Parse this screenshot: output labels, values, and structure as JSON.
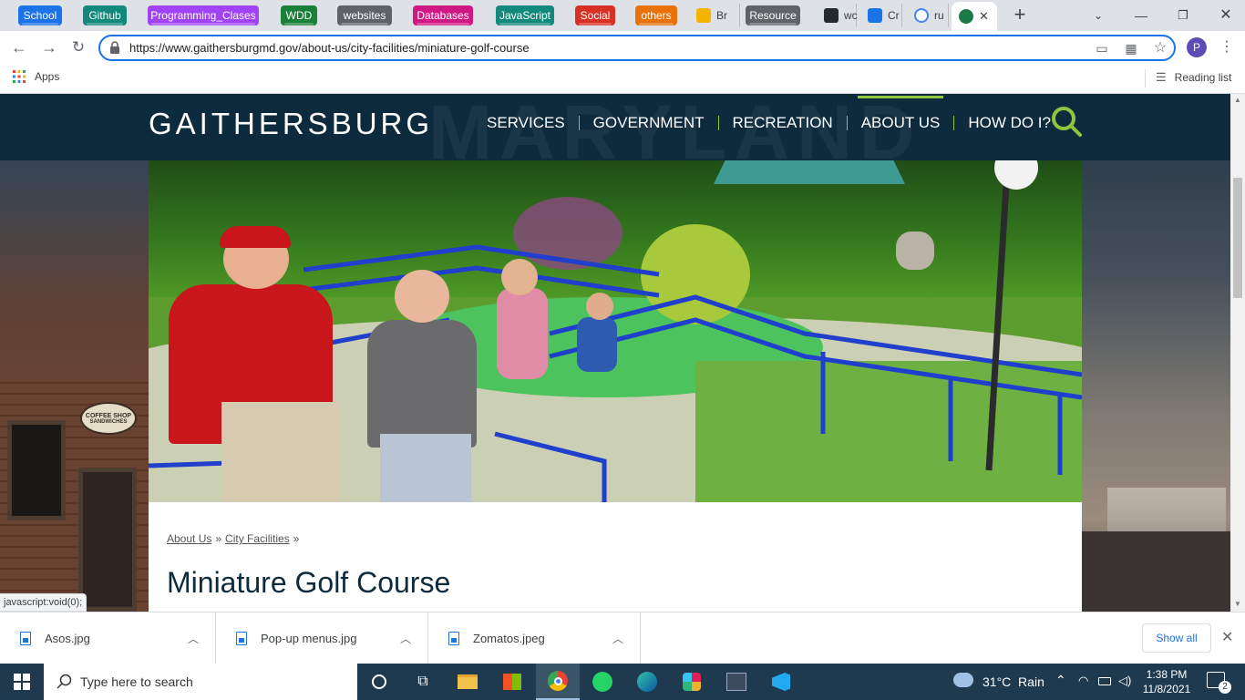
{
  "tabs": {
    "groups": [
      {
        "label": "School",
        "color": "#1a73e8"
      },
      {
        "label": "Github",
        "color": "#12897a"
      },
      {
        "label": "Programming_Clases",
        "color": "#a142f4"
      },
      {
        "label": "WDD",
        "color": "#188038"
      },
      {
        "label": "websites",
        "color": "#5f6368"
      },
      {
        "label": "Databases",
        "color": "#d01884"
      },
      {
        "label": "JavaScript",
        "color": "#12897a"
      },
      {
        "label": "Social",
        "color": "#d93025"
      },
      {
        "label": "others",
        "color": "#e8710a"
      },
      {
        "label": "Resource",
        "color": "#5f6368"
      }
    ],
    "pages": [
      {
        "label": "Br"
      },
      {
        "label": "wc"
      },
      {
        "label": "Cr"
      },
      {
        "label": "ru"
      }
    ],
    "new_tab": "+",
    "close_glyph": "✕"
  },
  "toolbar": {
    "url": "https://www.gaithersburgmd.gov/about-us/city-facilities/miniature-golf-course",
    "profile_initial": "P"
  },
  "bookmarks": {
    "apps_label": "Apps",
    "reading_list_label": "Reading list"
  },
  "site": {
    "logo": "GAITHERSBURG",
    "nav": [
      "SERVICES",
      "GOVERNMENT",
      "RECREATION",
      "ABOUT US",
      "HOW DO I?"
    ],
    "active_nav": "ABOUT US",
    "watermark": "MARYLAND",
    "breadcrumb": [
      "About Us",
      "City Facilities"
    ],
    "breadcrumb_sep": "»",
    "page_title": "Miniature Golf Course",
    "sign_lines": [
      "COFFEE SHOP",
      "SANDWICHES"
    ],
    "colors": {
      "header": "#0e2b3d",
      "accent": "#8dc63f",
      "title": "#0e2b3d"
    }
  },
  "status_bar": "javascript:void(0);",
  "downloads": {
    "items": [
      "Asos.jpg",
      "Pop-up menus.jpg",
      "Zomatos.jpeg"
    ],
    "show_all": "Show all"
  },
  "taskbar": {
    "search_placeholder": "Type here to search",
    "weather": "31°C  Rain",
    "time": "1:38 PM",
    "date": "11/8/2021",
    "notifications": "2"
  }
}
